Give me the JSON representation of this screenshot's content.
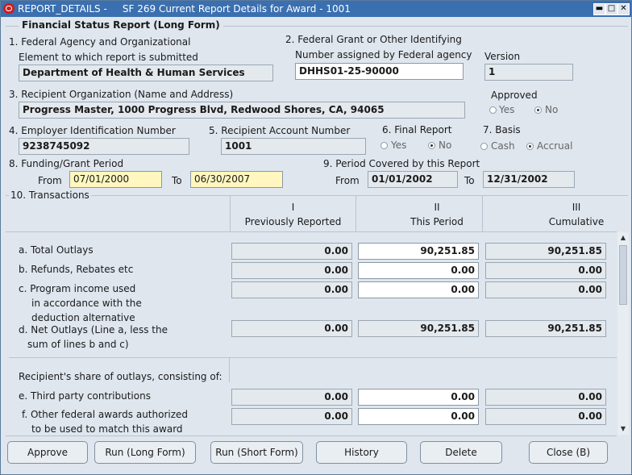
{
  "window": {
    "title": "REPORT_DETAILS -     SF 269 Current Report Details for Award - 1001",
    "minimize": "▬",
    "maximize": "□",
    "close": "✕"
  },
  "form": {
    "title": "Financial Status Report (Long Form)",
    "f1": {
      "label_a": "1. Federal Agency and Organizational",
      "label_b": "Element to which report is submitted",
      "value": "Department of Health & Human Services"
    },
    "f2": {
      "label_a": "2. Federal Grant or Other Identifying",
      "label_b": "Number assigned by Federal agency",
      "value": "DHHS01-25-90000"
    },
    "version": {
      "label": "Version",
      "value": "1"
    },
    "f3": {
      "label": "3. Recipient Organization (Name and Address)",
      "value": "Progress Master, 1000 Progress Blvd, Redwood Shores, CA, 94065"
    },
    "approved": {
      "label": "Approved",
      "yes": "Yes",
      "no": "No",
      "selected": "No"
    },
    "f4": {
      "label": "4. Employer Identification Number",
      "value": "9238745092"
    },
    "f5": {
      "label": "5. Recipient Account Number",
      "value": "1001"
    },
    "f6": {
      "label": "6. Final Report",
      "yes": "Yes",
      "no": "No",
      "selected": "No"
    },
    "f7": {
      "label": "7. Basis",
      "cash": "Cash",
      "accrual": "Accrual",
      "selected": "Accrual"
    },
    "f8": {
      "label": "8. Funding/Grant Period",
      "from_label": "From",
      "from": "07/01/2000",
      "to_label": "To",
      "to": "06/30/2007"
    },
    "f9": {
      "label": "9. Period Covered by this Report",
      "from_label": "From",
      "from": "01/01/2002",
      "to_label": "To",
      "to": "12/31/2002"
    },
    "f10": {
      "label": "10. Transactions"
    }
  },
  "columns": [
    {
      "roman": "I",
      "label": "Previously Reported"
    },
    {
      "roman": "II",
      "label": "This Period"
    },
    {
      "roman": "III",
      "label": "Cumulative"
    }
  ],
  "rows": {
    "a": {
      "label": "a. Total Outlays",
      "values": [
        "0.00",
        "90,251.85",
        "90,251.85"
      ]
    },
    "b": {
      "label": "b. Refunds, Rebates etc",
      "values": [
        "0.00",
        "0.00",
        "0.00"
      ]
    },
    "c": {
      "label_1": "c. Program income used",
      "label_2": "in accordance with the",
      "label_3": "deduction alternative",
      "values": [
        "0.00",
        "0.00",
        "0.00"
      ]
    },
    "d": {
      "label_1": "d. Net Outlays (Line a, less the",
      "label_2": "sum of lines b and c)",
      "values": [
        "0.00",
        "90,251.85",
        "90,251.85"
      ]
    },
    "share_label": "Recipient's share of outlays, consisting of:",
    "e": {
      "label": "e. Third party contributions",
      "values": [
        "0.00",
        "0.00",
        "0.00"
      ]
    },
    "f": {
      "label_1": "f. Other federal awards authorized",
      "label_2": "to be used to match this award",
      "values": [
        "0.00",
        "0.00",
        "0.00"
      ]
    }
  },
  "scrollbar": {
    "up": "▲",
    "down": "▼"
  },
  "buttons": {
    "approve": "Approve",
    "run_long": "Run (Long Form)",
    "run_short": "Run (Short Form)",
    "history": "History",
    "delete": "Delete",
    "close": "Close (B)"
  }
}
